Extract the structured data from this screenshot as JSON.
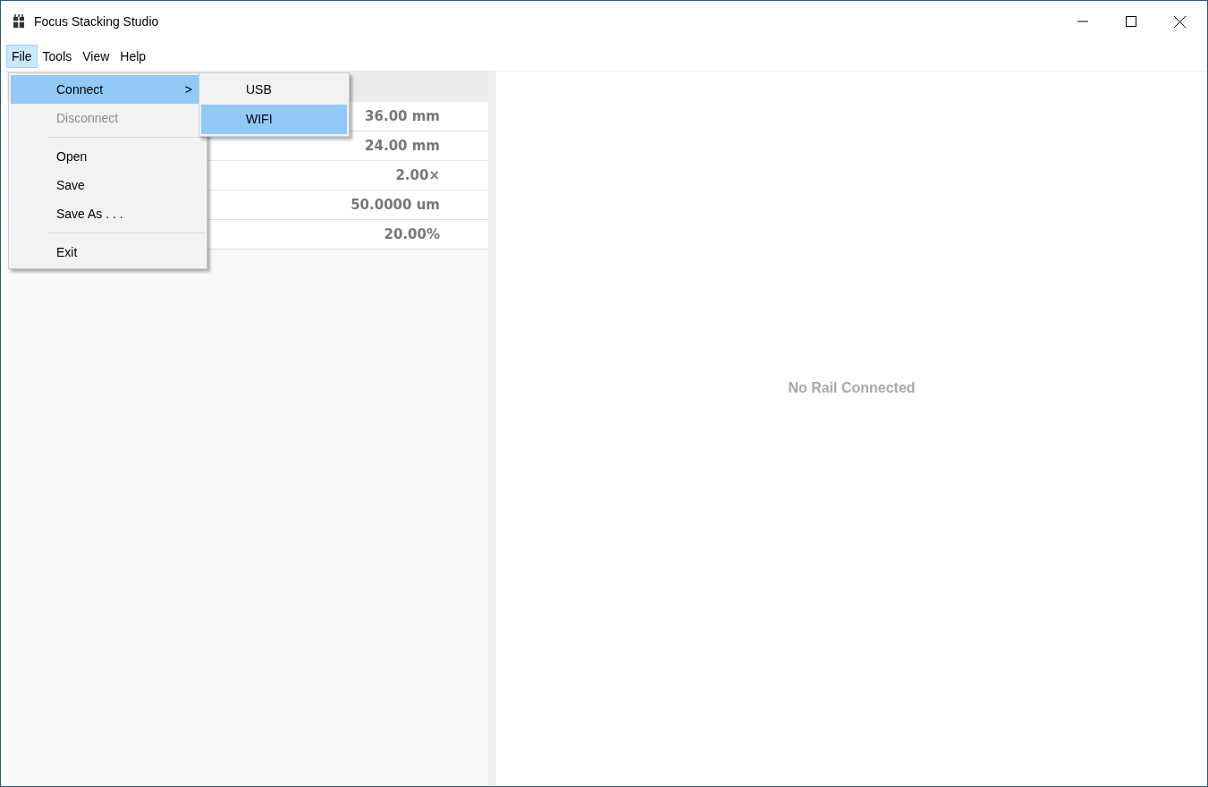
{
  "window": {
    "title": "Focus Stacking Studio"
  },
  "menu_bar": [
    {
      "label": "File",
      "selected": true
    },
    {
      "label": "Tools",
      "selected": false
    },
    {
      "label": "View",
      "selected": false
    },
    {
      "label": "Help",
      "selected": false
    }
  ],
  "file_menu": [
    {
      "kind": "item",
      "label": "Connect",
      "disabled": false,
      "selected": true,
      "submenu_arrow": ">"
    },
    {
      "kind": "item",
      "label": "Disconnect",
      "disabled": true,
      "selected": false
    },
    {
      "kind": "separator"
    },
    {
      "kind": "item",
      "label": "Open",
      "disabled": false,
      "selected": false
    },
    {
      "kind": "item",
      "label": "Save",
      "disabled": false,
      "selected": false
    },
    {
      "kind": "item",
      "label": "Save As . . .",
      "disabled": false,
      "selected": false
    },
    {
      "kind": "separator"
    },
    {
      "kind": "item",
      "label": "Exit",
      "disabled": false,
      "selected": false
    }
  ],
  "connect_submenu": [
    {
      "label": "USB",
      "selected": false
    },
    {
      "label": "WIFI",
      "selected": true
    }
  ],
  "settings_table": {
    "rows": [
      {
        "value": "36.00 mm"
      },
      {
        "value": "24.00 mm"
      },
      {
        "value": "2.00×"
      },
      {
        "value": "50.0000 um"
      },
      {
        "value": "20.00%"
      }
    ]
  },
  "rail_panel": {
    "message": "No Rail Connected"
  }
}
